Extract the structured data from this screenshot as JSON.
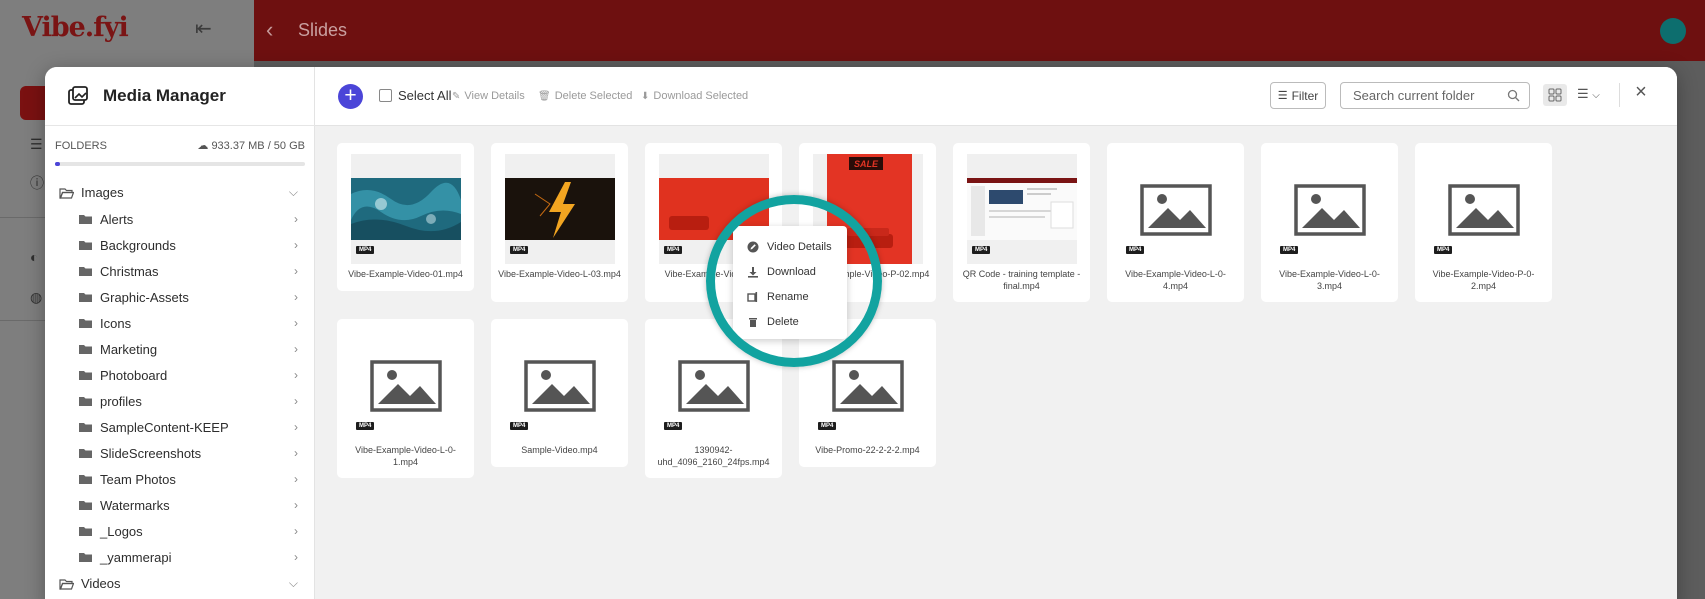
{
  "app": {
    "logo_text": "Vibe.fyi",
    "page_title": "Slides",
    "brand_color": "#7a1414",
    "topbar_color": "#6e1010"
  },
  "modal": {
    "title": "Media Manager",
    "folders_label": "FOLDERS",
    "storage_text": "933.37 MB / 50 GB",
    "storage_used_fraction": 0.018,
    "tree": [
      {
        "label": "Images",
        "level": 0,
        "expanded": true
      },
      {
        "label": "Alerts",
        "level": 1
      },
      {
        "label": "Backgrounds",
        "level": 1
      },
      {
        "label": "Christmas",
        "level": 1
      },
      {
        "label": "Graphic-Assets",
        "level": 1
      },
      {
        "label": "Icons",
        "level": 1
      },
      {
        "label": "Marketing",
        "level": 1
      },
      {
        "label": "Photoboard",
        "level": 1
      },
      {
        "label": "profiles",
        "level": 1
      },
      {
        "label": "SampleContent-KEEP",
        "level": 1
      },
      {
        "label": "SlideScreenshots",
        "level": 1
      },
      {
        "label": "Team Photos",
        "level": 1
      },
      {
        "label": "Watermarks",
        "level": 1
      },
      {
        "label": "_Logos",
        "level": 1
      },
      {
        "label": "_yammerapi",
        "level": 1
      },
      {
        "label": "Videos",
        "level": 0,
        "expanded": true
      }
    ]
  },
  "toolbar": {
    "add_label": "+",
    "select_all": "Select All",
    "view_details": "View Details",
    "delete_selected": "Delete Selected",
    "download_selected": "Download Selected",
    "filter": "Filter",
    "search_placeholder": "Search current folder",
    "close_label": "×"
  },
  "files": [
    {
      "name": "Vibe-Example-Video-01.mp4",
      "type": "MP4",
      "thumb": "ocean"
    },
    {
      "name": "Vibe-Example-Video-L-03.mp4",
      "type": "MP4",
      "thumb": "lightning"
    },
    {
      "name": "Vibe-Example-Video-L-0",
      "type": "MP4",
      "thumb": "red-sofa"
    },
    {
      "name": "Vibe-Example-Video-P-02.mp4",
      "type": "MP4",
      "thumb": "sale"
    },
    {
      "name": "QR Code - training template - final.mp4",
      "type": "MP4",
      "thumb": "screenshot"
    },
    {
      "name": "Vibe-Example-Video-L-0-4.mp4",
      "type": "MP4",
      "thumb": "placeholder"
    },
    {
      "name": "Vibe-Example-Video-L-0-3.mp4",
      "type": "MP4",
      "thumb": "placeholder"
    },
    {
      "name": "Vibe-Example-Video-P-0-2.mp4",
      "type": "MP4",
      "thumb": "placeholder"
    },
    {
      "name": "Vibe-Example-Video-L-0-1.mp4",
      "type": "MP4",
      "thumb": "placeholder"
    },
    {
      "name": "Sample-Video.mp4",
      "type": "MP4",
      "thumb": "placeholder"
    },
    {
      "name": "1390942-uhd_4096_2160_24fps.mp4",
      "type": "MP4",
      "thumb": "placeholder"
    },
    {
      "name": "Vibe-Promo-22-2-2-2.mp4",
      "type": "MP4",
      "thumb": "placeholder"
    }
  ],
  "context_menu": {
    "items": [
      {
        "label": "Video Details",
        "icon": "pencil-icon"
      },
      {
        "label": "Download",
        "icon": "download-icon"
      },
      {
        "label": "Rename",
        "icon": "rename-icon"
      },
      {
        "label": "Delete",
        "icon": "trash-icon"
      }
    ],
    "highlight_color": "#12a3a0"
  },
  "thumb_text": {
    "sale": "SALE"
  }
}
